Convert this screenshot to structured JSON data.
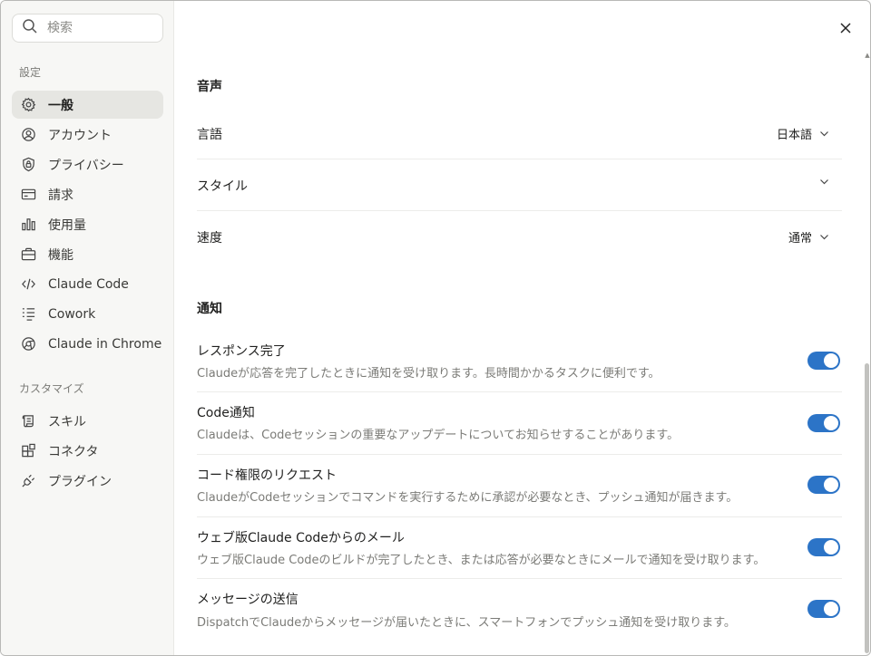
{
  "search": {
    "placeholder": "検索",
    "icon": "search-icon"
  },
  "sidebar": {
    "settings_label": "設定",
    "items": [
      {
        "label": "一般",
        "icon": "gear-icon",
        "active": true
      },
      {
        "label": "アカウント",
        "icon": "user-circle-icon"
      },
      {
        "label": "プライバシー",
        "icon": "shield-lock-icon"
      },
      {
        "label": "請求",
        "icon": "credit-card-icon"
      },
      {
        "label": "使用量",
        "icon": "bar-chart-icon"
      },
      {
        "label": "機能",
        "icon": "briefcase-icon"
      },
      {
        "label": "Claude Code",
        "icon": "code-icon"
      },
      {
        "label": "Cowork",
        "icon": "list-icon"
      },
      {
        "label": "Claude in Chrome",
        "icon": "globe-icon"
      }
    ],
    "customize_label": "カスタマイズ",
    "customize_items": [
      {
        "label": "スキル",
        "icon": "scroll-icon"
      },
      {
        "label": "コネクタ",
        "icon": "blocks-icon"
      },
      {
        "label": "プラグイン",
        "icon": "plug-icon"
      }
    ]
  },
  "main": {
    "voice": {
      "title": "音声",
      "rows": [
        {
          "label": "言語",
          "value": "日本語"
        },
        {
          "label": "スタイル",
          "value": ""
        },
        {
          "label": "速度",
          "value": "通常"
        }
      ]
    },
    "notifications": {
      "title": "通知",
      "items": [
        {
          "title": "レスポンス完了",
          "desc": "Claudeが応答を完了したときに通知を受け取ります。長時間かかるタスクに便利です。",
          "enabled": true
        },
        {
          "title": "Code通知",
          "desc": "Claudeは、Codeセッションの重要なアップデートについてお知らせすることがあります。",
          "enabled": true
        },
        {
          "title": "コード権限のリクエスト",
          "desc": "ClaudeがCodeセッションでコマンドを実行するために承認が必要なとき、プッシュ通知が届きます。",
          "enabled": true
        },
        {
          "title": "ウェブ版Claude Codeからのメール",
          "desc": "ウェブ版Claude Codeのビルドが完了したとき、または応答が必要なときにメールで通知を受け取ります。",
          "enabled": true
        },
        {
          "title": "メッセージの送信",
          "desc": "DispatchでClaudeからメッセージが届いたときに、スマートフォンでプッシュ通知を受け取ります。",
          "enabled": true
        }
      ]
    }
  },
  "colors": {
    "accent": "#2c74c7",
    "sidebar_bg": "#f7f7f5",
    "active_bg": "#e6e6e2"
  }
}
